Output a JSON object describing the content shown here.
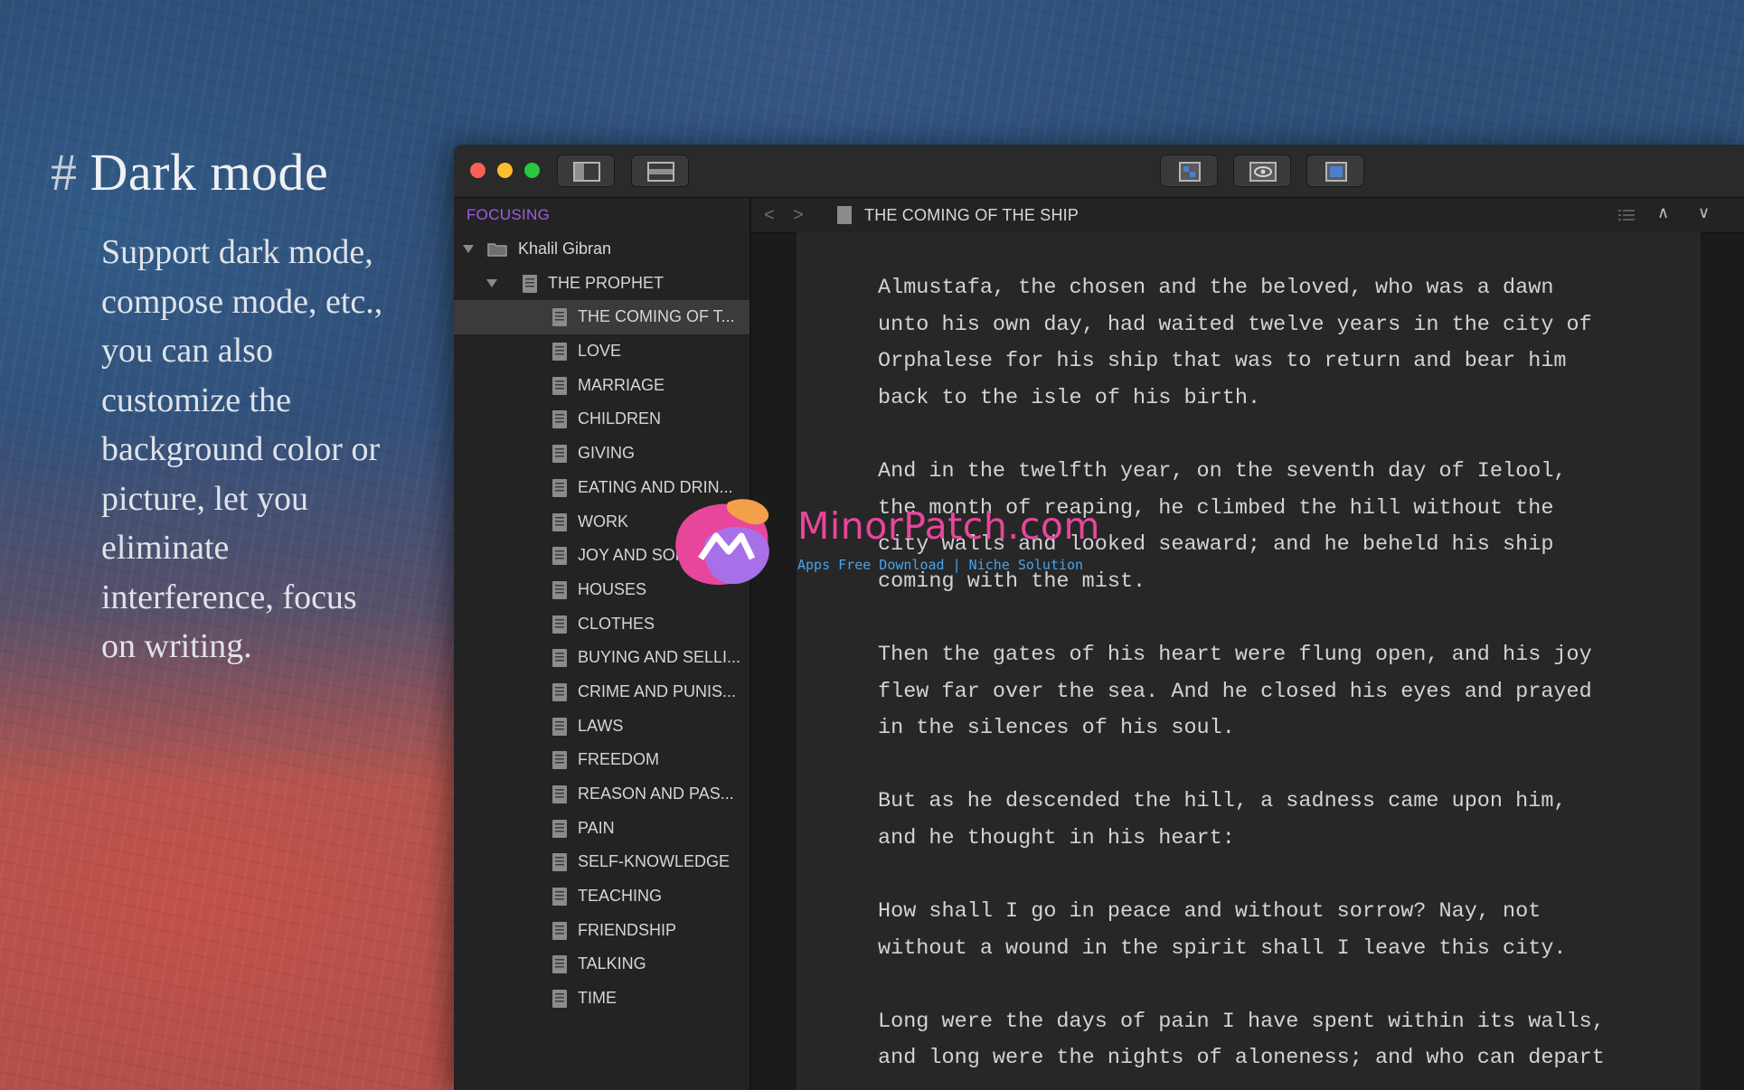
{
  "promo": {
    "hash": "#",
    "title": "Dark mode",
    "description": "Support dark mode, compose mode, etc., you can also customize the background color or picture, let you eliminate interference, focus on writing."
  },
  "toolbar": {
    "left_buttons": [
      "sidebar-toggle-icon",
      "layout-icon"
    ],
    "right_buttons": [
      "preview-icon",
      "eye-icon",
      "export-icon"
    ]
  },
  "sidebar": {
    "header": "FOCUSING",
    "folder": "Khalil Gibran",
    "book": "THE PROPHET",
    "items": [
      "THE COMING OF T...",
      "LOVE",
      "MARRIAGE",
      "CHILDREN",
      "GIVING",
      "EATING AND DRIN...",
      "WORK",
      "JOY AND SORROW",
      "HOUSES",
      "CLOTHES",
      "BUYING AND SELLI...",
      "CRIME AND PUNIS...",
      "LAWS",
      "FREEDOM",
      "REASON AND PAS...",
      "PAIN",
      "SELF-KNOWLEDGE",
      "TEACHING",
      "FRIENDSHIP",
      "TALKING",
      "TIME"
    ],
    "selected_index": 0
  },
  "navbar": {
    "back": "<",
    "forward": ">",
    "title": "THE COMING OF THE SHIP",
    "up": "∧",
    "down": "∨"
  },
  "editor": {
    "paragraphs": [
      "Almustafa, the chosen and the beloved, who was a dawn\nunto his own day, had waited twelve years in the city of\nOrphalese for his ship that was to return and bear him\nback to the isle of his birth.",
      "And in the twelfth year, on the seventh day of Ielool,\nthe month of reaping, he climbed the hill without the\ncity walls and looked seaward; and he beheld his ship\ncoming with the mist.",
      "Then the gates of his heart were flung open, and his joy\nflew far over the sea. And he closed his eyes and prayed\nin the silences of his soul.",
      "But as he descended the hill, a sadness came upon him,\nand he thought in his heart:",
      "How shall I go in peace and without sorrow? Nay, not\nwithout a wound in the spirit shall I leave this city.",
      "Long were the days of pain I have spent within its walls,\nand long were the nights of aloneness; and who can depart"
    ]
  },
  "watermark": {
    "title": "MinorPatch.com",
    "subtitle": "Apps Free Download | Niche Solution"
  },
  "colors": {
    "accent": "#9b5fe0",
    "watermark_pink": "#e8469a",
    "watermark_blue": "#4aa3e8"
  }
}
